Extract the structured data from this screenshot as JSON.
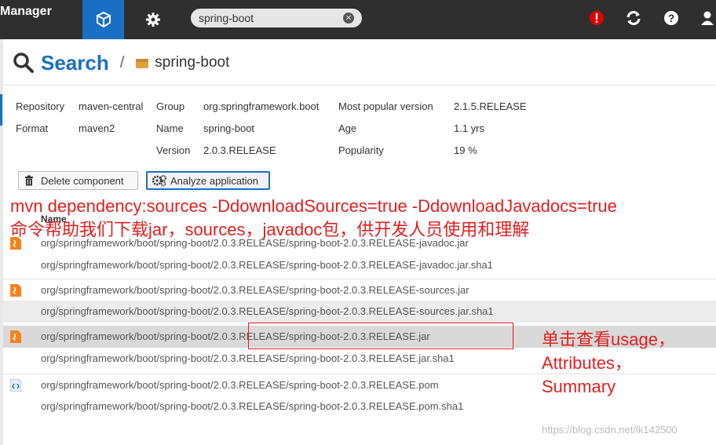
{
  "header": {
    "brand": "Manager",
    "search_value": "spring-boot"
  },
  "title": {
    "search_label": "Search",
    "separator": "/",
    "component": "spring-boot"
  },
  "info": {
    "repository_key": "Repository",
    "repository_val": "maven-central",
    "format_key": "Format",
    "format_val": "maven2",
    "group_key": "Group",
    "group_val": "org.springframework.boot",
    "name_key": "Name",
    "name_val": "spring-boot",
    "version_key": "Version",
    "version_val": "2.0.3.RELEASE",
    "popular_key": "Most popular version",
    "popular_val": "2.1.5.RELEASE",
    "age_key": "Age",
    "age_val": "1.1 yrs",
    "popularity_key": "Popularity",
    "popularity_val": "19 %"
  },
  "buttons": {
    "delete": "Delete component",
    "analyze": "Analyze application"
  },
  "table": {
    "name_header": "Name",
    "rows": [
      "org/springframework/boot/spring-boot/2.0.3.RELEASE/spring-boot-2.0.3.RELEASE-javadoc.jar",
      "org/springframework/boot/spring-boot/2.0.3.RELEASE/spring-boot-2.0.3.RELEASE-javadoc.jar.sha1",
      "org/springframework/boot/spring-boot/2.0.3.RELEASE/spring-boot-2.0.3.RELEASE-sources.jar",
      "org/springframework/boot/spring-boot/2.0.3.RELEASE/spring-boot-2.0.3.RELEASE-sources.jar.sha1",
      "org/springframework/boot/spring-boot/2.0.3.RELEASE/spring-boot-2.0.3.RELEASE.jar",
      "org/springframework/boot/spring-boot/2.0.3.RELEASE/spring-boot-2.0.3.RELEASE.jar.sha1",
      "org/springframework/boot/spring-boot/2.0.3.RELEASE/spring-boot-2.0.3.RELEASE.pom",
      "org/springframework/boot/spring-boot/2.0.3.RELEASE/spring-boot-2.0.3.RELEASE.pom.sha1"
    ]
  },
  "annotations": {
    "line1": "mvn dependency:sources -DdownloadSources=true -DdownloadJavadocs=true",
    "line2": "命令帮助我们下载jar，sources，javadoc包，供开发人员使用和理解",
    "side1": "单击查看usage，",
    "side2": "Attributes，",
    "side3": "Summary"
  },
  "watermark": "https://blog.csdn.net/lk142500",
  "icons": [
    "cube-icon",
    "gear-icon",
    "alert-icon",
    "refresh-icon",
    "help-icon",
    "user-icon",
    "search-icon",
    "box-icon",
    "trash-icon",
    "gears-icon",
    "java-file-icon",
    "xml-file-icon"
  ],
  "colors": {
    "accent": "#1a6fc4",
    "topbar": "#2f2f2f",
    "annotation": "#e02020",
    "alert": "#e00000",
    "java_icon": "#f58220"
  }
}
